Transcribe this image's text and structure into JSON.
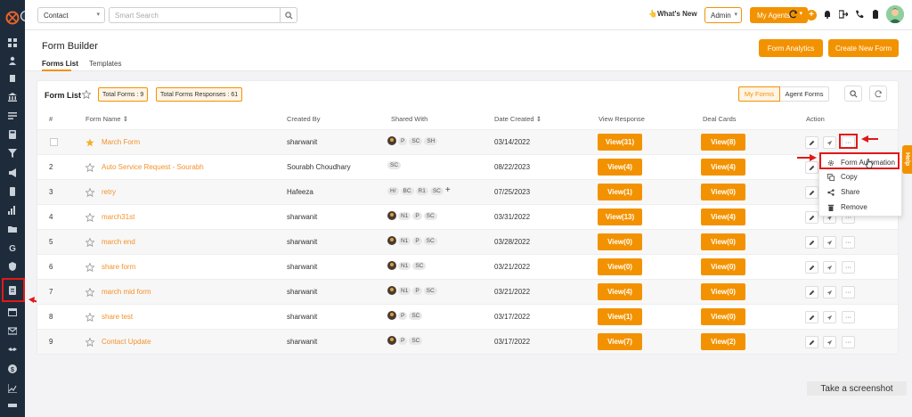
{
  "topbar": {
    "contact_select": "Contact",
    "search_placeholder": "Smart Search",
    "whats_new": "What's New",
    "admin_select": "Admin",
    "my_agents": "My Agents"
  },
  "page": {
    "title": "Form Builder",
    "tabs": [
      {
        "label": "Forms List",
        "active": true
      },
      {
        "label": "Templates",
        "active": false
      }
    ],
    "form_analytics_label": "Form Analytics",
    "create_form_label": "Create New Form"
  },
  "card": {
    "title": "Form List",
    "total_forms": "Total Forms : 9",
    "total_responses": "Total Forms Responses : 61",
    "toggle": [
      "My Forms",
      "Agent Forms"
    ],
    "active_toggle": "My Forms"
  },
  "table": {
    "headers": [
      "#",
      "Form Name",
      "Created By",
      "Shared With",
      "Date Created",
      "View Response",
      "Deal Cards",
      "Action"
    ],
    "rows": [
      {
        "num": "",
        "name": "March Form",
        "starred": true,
        "created_by": "sharwanit",
        "shared": [
          "P",
          "SC",
          "SH"
        ],
        "date": "03/14/2022",
        "view": "View(31)",
        "deal": "View(8)"
      },
      {
        "num": "2",
        "name": "Auto Service Request - Sourabh",
        "starred": false,
        "created_by": "Sourabh Choudhary",
        "shared": [
          "SC"
        ],
        "date": "08/22/2023",
        "view": "View(4)",
        "deal": "View(4)"
      },
      {
        "num": "3",
        "name": "retry",
        "starred": false,
        "created_by": "Hafeeza",
        "shared": [
          "H/",
          "BC",
          "R1",
          "SC"
        ],
        "date": "07/25/2023",
        "view": "View(1)",
        "deal": "View(0)"
      },
      {
        "num": "4",
        "name": "march31st",
        "starred": false,
        "created_by": "sharwanit",
        "shared": [
          "N1",
          "P",
          "SC"
        ],
        "date": "03/31/2022",
        "view": "View(13)",
        "deal": "View(4)"
      },
      {
        "num": "5",
        "name": "march end",
        "starred": false,
        "created_by": "sharwanit",
        "shared": [
          "N1",
          "P",
          "SC"
        ],
        "date": "03/28/2022",
        "view": "View(0)",
        "deal": "View(0)"
      },
      {
        "num": "6",
        "name": "share form",
        "starred": false,
        "created_by": "sharwanit",
        "shared": [
          "N1",
          "SC"
        ],
        "date": "03/21/2022",
        "view": "View(0)",
        "deal": "View(0)"
      },
      {
        "num": "7",
        "name": "march mid form",
        "starred": false,
        "created_by": "sharwanit",
        "shared": [
          "N1",
          "P",
          "SC"
        ],
        "date": "03/21/2022",
        "view": "View(4)",
        "deal": "View(0)"
      },
      {
        "num": "8",
        "name": "share test",
        "starred": false,
        "created_by": "sharwanit",
        "shared": [
          "P",
          "SC"
        ],
        "date": "03/17/2022",
        "view": "View(1)",
        "deal": "View(0)"
      },
      {
        "num": "9",
        "name": "Contact Update",
        "starred": false,
        "created_by": "sharwanit",
        "shared": [
          "P",
          "SC"
        ],
        "date": "03/17/2022",
        "view": "View(7)",
        "deal": "View(2)"
      }
    ]
  },
  "menu": {
    "items": [
      {
        "label": "Form Automation",
        "icon": "gear-icon"
      },
      {
        "label": "Copy",
        "icon": "copy-icon"
      },
      {
        "label": "Share",
        "icon": "share-icon"
      },
      {
        "label": "Remove",
        "icon": "trash-icon"
      }
    ]
  },
  "help_tab": "Help",
  "screenshot_label": "Take a screenshot",
  "colors": {
    "accent": "#f39200",
    "sidebar": "#1e2b3a",
    "highlight": "#e01919"
  }
}
